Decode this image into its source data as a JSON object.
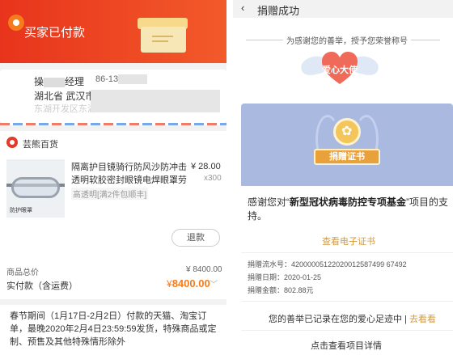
{
  "left": {
    "header_title": "买家已付款",
    "address": {
      "name_prefix": "操",
      "name_suffix": "经理",
      "phone_prefix": "86-13",
      "line2": "湖北省 武汉市",
      "line3": "东湖开发区东湖"
    },
    "store_name": "芸熊百货",
    "product": {
      "image_tag": "防护眼罩",
      "title": "隔离护目镜骑行防风沙防冲击透明软胶密封眼镜电焊眼罩劳保...",
      "price": "¥ 28.00",
      "qty": "x300",
      "spec": "高透明[满2件包顺丰]"
    },
    "refund_button": "退款",
    "total_label": "商品总价",
    "total_value": "¥ 8400.00",
    "paid_label": "实付款（含运费）",
    "paid_currency": "¥",
    "paid_value": "8400.00",
    "notice": "春节期间（1月17日-2月2日）付款的天猫、淘宝订单，最晚2020年2月4日23:59:59发货，特殊商品或定制、预售及其他特殊情形除外"
  },
  "right": {
    "back_icon": "‹",
    "nav_title": "捐赠成功",
    "thanks_text": "为感谢您的善举，授予您荣誉称号",
    "badge_text": "爱心大使",
    "certificate_ribbon": "捐赠证书",
    "support_prefix": "感谢您对“",
    "support_fund": "新型冠状病毒防控专项基金",
    "support_suffix": "”项目的支持。",
    "view_certificate": "查看电子证书",
    "serial_label": "捐赠流水号：",
    "serial_value": "42000005122020012587499 67492",
    "date_label": "捐赠日期：",
    "date_value": "2020-01-25",
    "amount_label": "捐赠金额：",
    "amount_value": "802.88元",
    "footprint_text": "您的善举已记录在您的爱心足迹中 | ",
    "footprint_link": "去看看",
    "detail_link": "点击查看项目详情"
  }
}
